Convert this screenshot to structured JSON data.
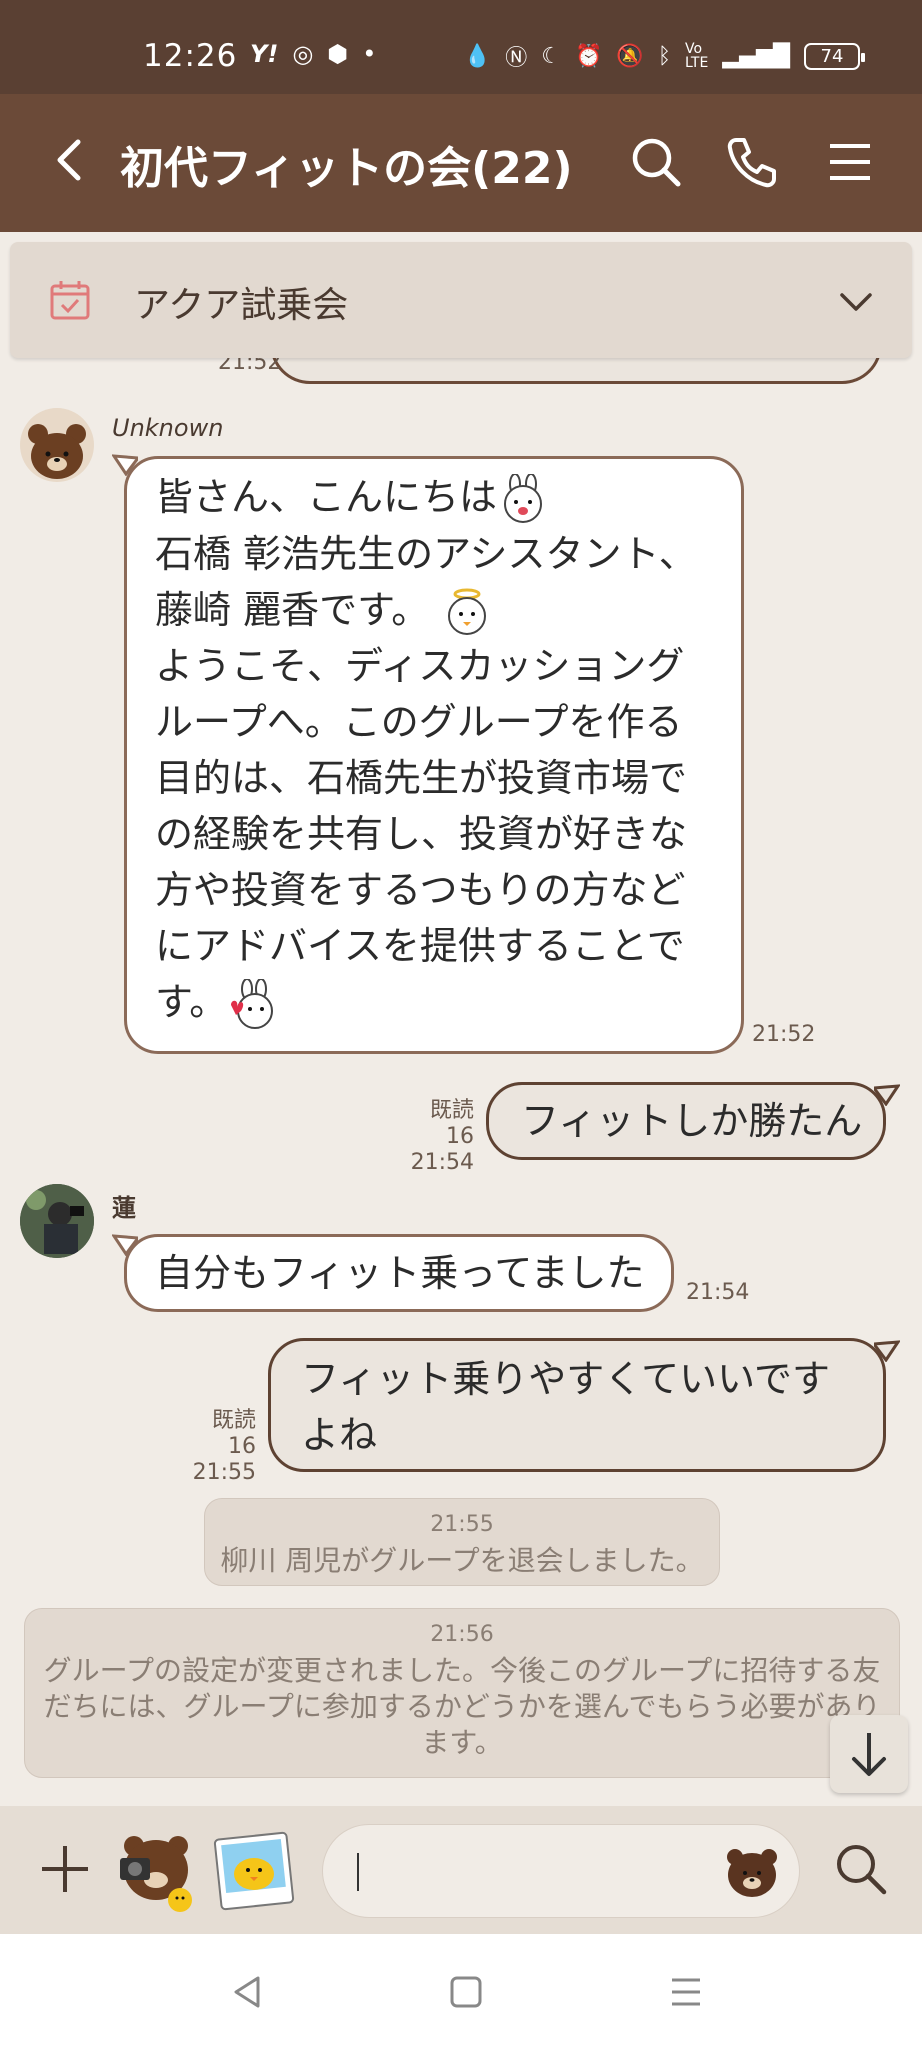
{
  "status_bar": {
    "time": "12:26",
    "battery": "74"
  },
  "header": {
    "title": "初代フィットの会(22)"
  },
  "announcement": {
    "text": "アクア試乗会"
  },
  "partial_prev": {
    "time": "21:52"
  },
  "messages": {
    "m1": {
      "sender": "Unknown",
      "lines": [
        "皆さん、こんにちは",
        "石橋 彰浩先生のアシスタント、",
        "藤崎 麗香です。",
        "ようこそ、ディスカッショング",
        "ループへ。このグループを作る",
        "目的は、石橋先生が投資市場で",
        "の経験を共有し、投資が好きな",
        "方や投資をするつもりの方など",
        "にアドバイスを提供することで",
        "す。"
      ],
      "time": "21:52"
    },
    "m2": {
      "text": "フィットしか勝たん",
      "read": "既読 16",
      "time": "21:54"
    },
    "m3": {
      "sender": "蓮",
      "text": "自分もフィット乗ってました",
      "time": "21:54"
    },
    "m4": {
      "lines": [
        "フィット乗りやすくていいです",
        "よね"
      ],
      "read": "既読 16",
      "time": "21:55"
    },
    "sys1": {
      "time": "21:55",
      "text": "柳川 周児がグループを退会しました。"
    },
    "sys2": {
      "time": "21:56",
      "lines": [
        "グループの設定が変更されました。今後このグループに招待する友",
        "だちには、グループに参加するかどうかを選んでもらう必要があり",
        "ます。"
      ]
    }
  },
  "icons": {
    "back": "back-arrow-icon",
    "search": "search-icon",
    "call": "phone-icon",
    "menu": "menu-icon",
    "calendar": "calendar-icon",
    "expand": "chevron-down-icon",
    "scroll": "arrow-down-icon",
    "plus": "plus-icon"
  },
  "colors": {
    "header": "#6b4a38",
    "statusbar": "#5a4033",
    "background": "#f1ece6"
  }
}
